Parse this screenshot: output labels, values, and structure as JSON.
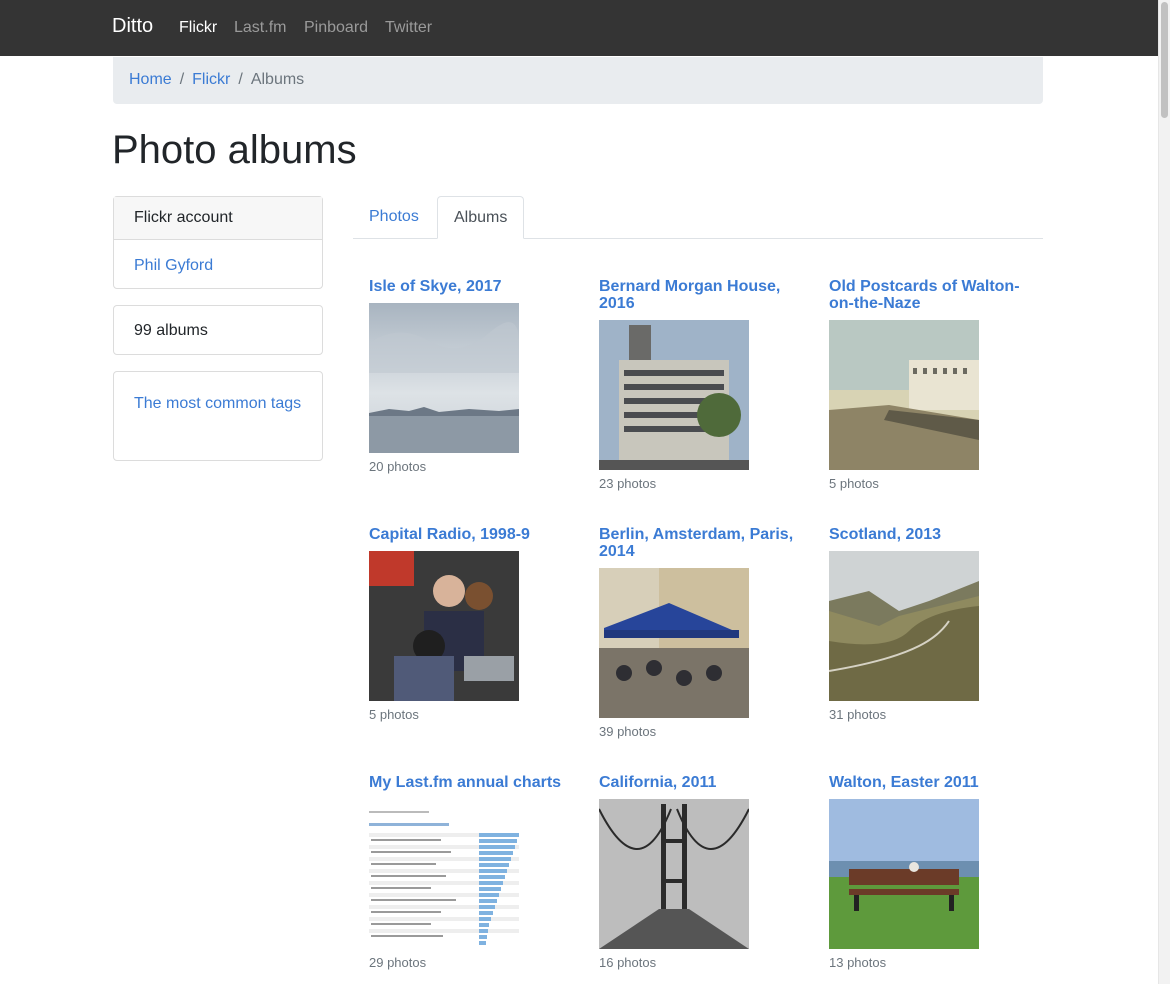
{
  "navbar": {
    "brand": "Ditto",
    "links": [
      "Flickr",
      "Last.fm",
      "Pinboard",
      "Twitter"
    ]
  },
  "breadcrumb": [
    "Home",
    "Flickr",
    "Albums"
  ],
  "page_title": "Photo albums",
  "sidebar": {
    "account_header": "Flickr account",
    "account_name": "Phil Gyford",
    "album_count": "99 albums",
    "tags_link": "The most common tags"
  },
  "tabs": [
    "Photos",
    "Albums"
  ],
  "albums": [
    {
      "title": "Isle of Skye, 2017",
      "count": "20 photos",
      "thumb": "sea-landscape"
    },
    {
      "title": "Bernard Morgan House, 2016",
      "count": "23 photos",
      "thumb": "building"
    },
    {
      "title": "Old Postcards of Walton-on-the-Naze",
      "count": "5 photos",
      "thumb": "postcard"
    },
    {
      "title": "Capital Radio, 1998-9",
      "count": "5 photos",
      "thumb": "people-computer"
    },
    {
      "title": "Berlin, Amsterdam, Paris, 2014",
      "count": "39 photos",
      "thumb": "cafe"
    },
    {
      "title": "Scotland, 2013",
      "count": "31 photos",
      "thumb": "valley"
    },
    {
      "title": "My Last.fm annual charts",
      "count": "29 photos",
      "thumb": "chart-screenshot"
    },
    {
      "title": "California, 2011",
      "count": "16 photos",
      "thumb": "bridge"
    },
    {
      "title": "Walton, Easter 2011",
      "count": "13 photos",
      "thumb": "bench"
    }
  ]
}
